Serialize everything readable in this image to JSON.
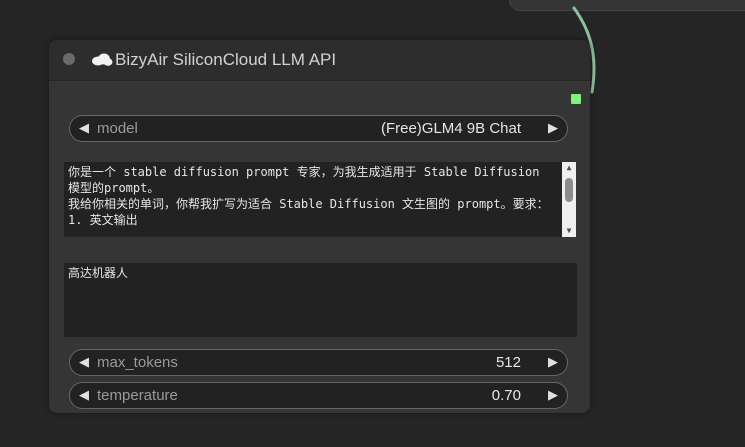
{
  "node": {
    "title": "BizyAir SiliconCloud LLM API",
    "icon": "cloud-icon",
    "output_slot_color": "#7df27d",
    "model": {
      "label": "model",
      "value": "(Free)GLM4 9B Chat"
    },
    "system_prompt": {
      "lines": [
        "你是一个 stable diffusion prompt 专家，为我生成适用于 Stable Diffusion 模型的prompt。",
        "我给你相关的单词，你帮我扩写为适合 Stable Diffusion 文生图的 prompt。要求：",
        "1. 英文输出"
      ]
    },
    "user_prompt": {
      "value": "高达机器人"
    },
    "max_tokens": {
      "label": "max_tokens",
      "value": "512"
    },
    "temperature": {
      "label": "temperature",
      "value": "0.70"
    }
  },
  "colors": {
    "canvas": "#252525",
    "node_body": "#353535",
    "link": "#8fbf9a"
  }
}
